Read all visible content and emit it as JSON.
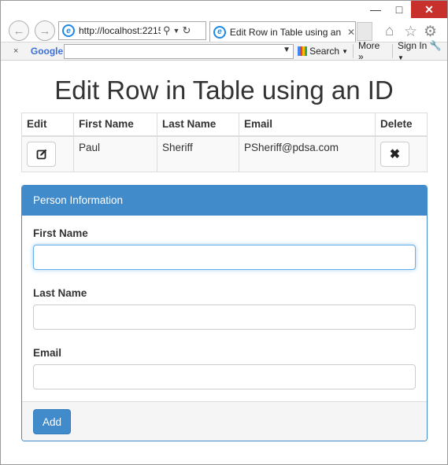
{
  "window": {
    "minimize": "—",
    "maximize": "□",
    "close": "✕"
  },
  "browser": {
    "back_icon": "back-arrow-icon",
    "forward_icon": "forward-arrow-icon",
    "address": "http://localhost:2215",
    "tab_title": "Edit Row in Table using an I...",
    "home_icon": "home-icon",
    "favorites_icon": "star-icon",
    "tools_icon": "gear-icon"
  },
  "google_toolbar": {
    "close": "×",
    "logo": "Google",
    "search_label": "Search",
    "more_label": "More",
    "signin_label": "Sign In"
  },
  "page": {
    "title": "Edit Row in Table using an ID",
    "table": {
      "headers": [
        "Edit",
        "First Name",
        "Last Name",
        "Email",
        "Delete"
      ],
      "rows": [
        {
          "first_name": "Paul",
          "last_name": "Sheriff",
          "email": "PSheriff@pdsa.com"
        }
      ]
    },
    "panel": {
      "title": "Person Information",
      "first_name_label": "First Name",
      "last_name_label": "Last Name",
      "email_label": "Email",
      "first_name_value": "",
      "last_name_value": "",
      "email_value": "",
      "add_button": "Add"
    }
  },
  "colors": {
    "primary": "#428bca",
    "close_button": "#c7302b"
  }
}
